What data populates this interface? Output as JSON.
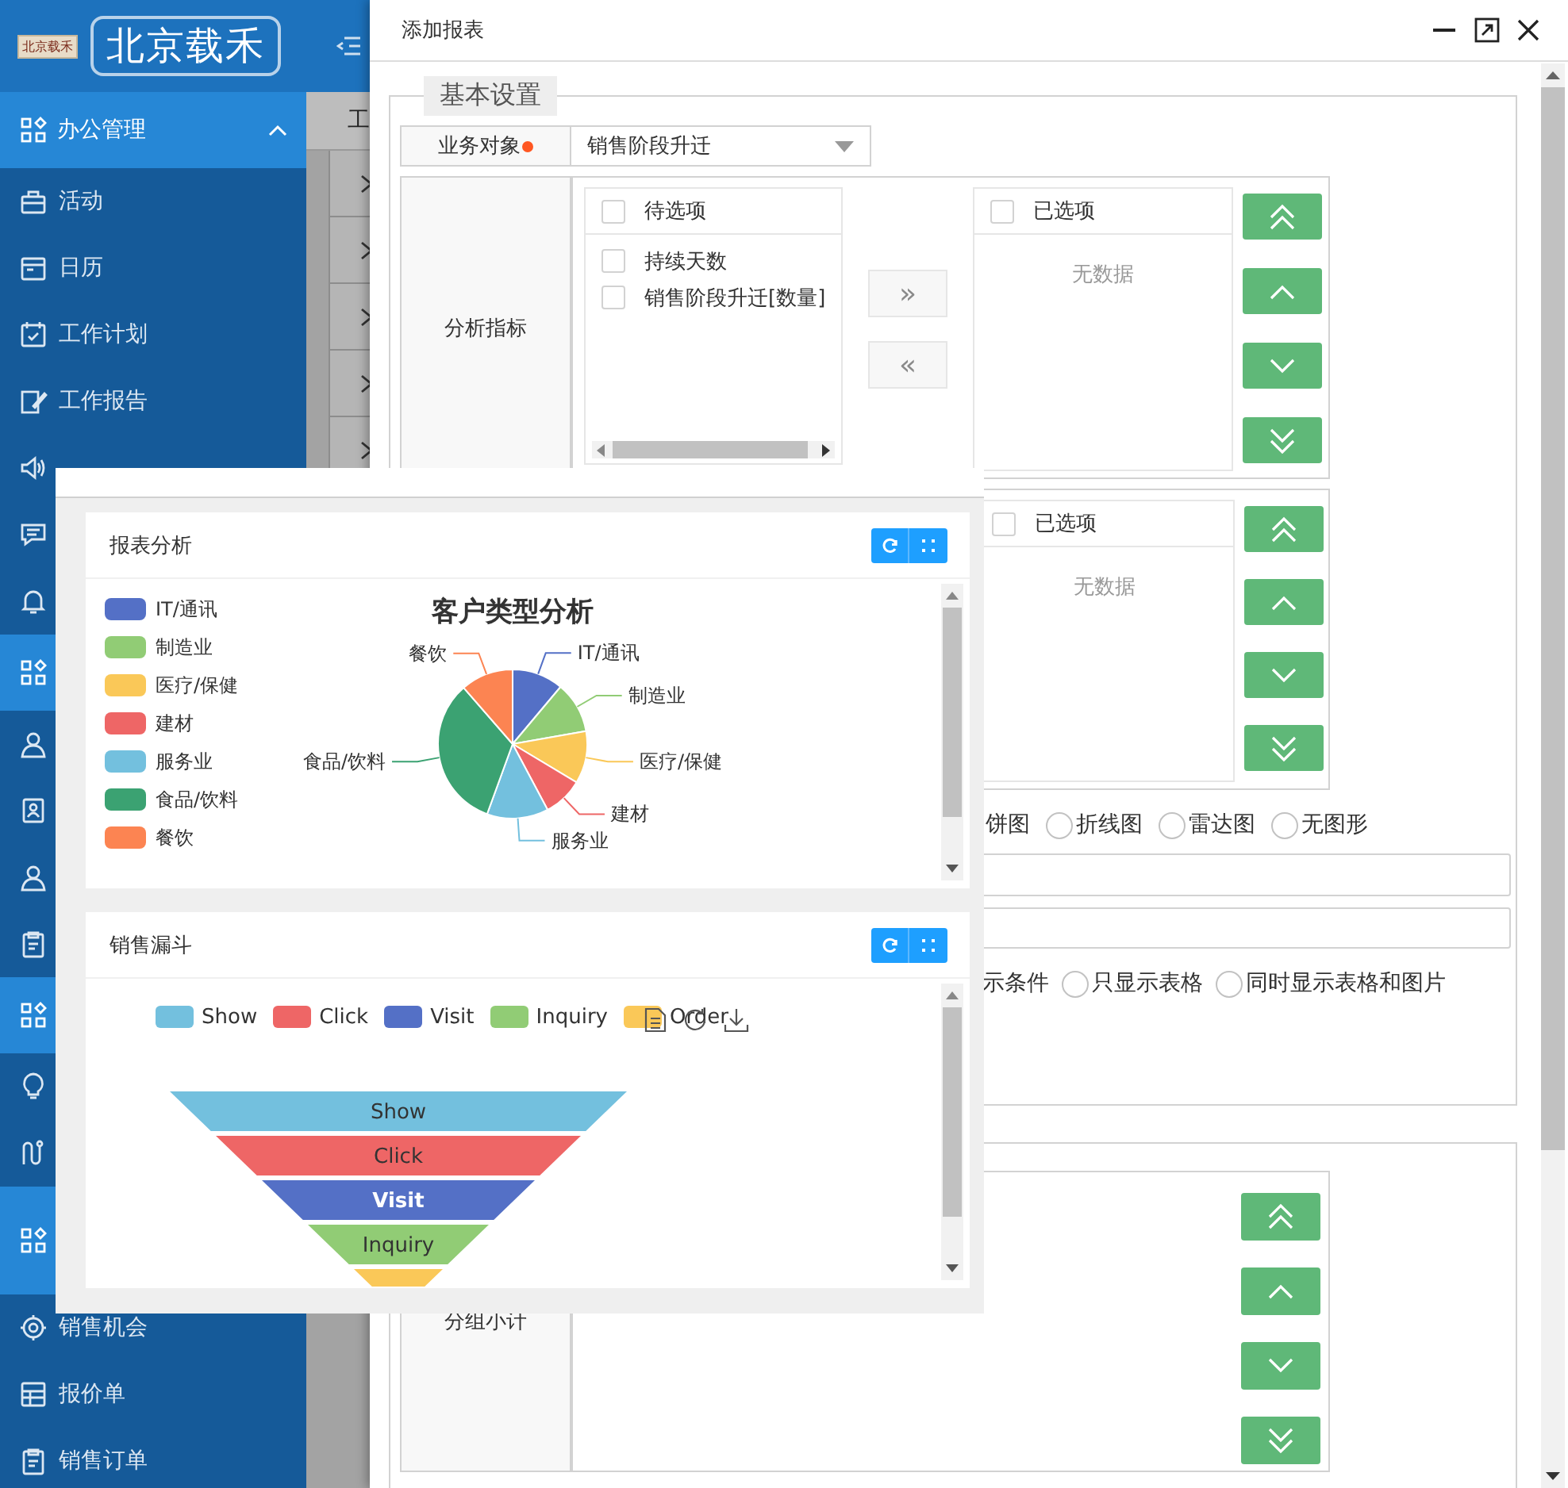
{
  "sidebar": {
    "logo_small": "北京载禾",
    "logo": "北京载禾",
    "items": [
      {
        "kind": "group",
        "label": "办公管理",
        "expanded": true
      },
      {
        "kind": "item",
        "label": "活动"
      },
      {
        "kind": "item",
        "label": "日历"
      },
      {
        "kind": "item",
        "label": "工作计划"
      },
      {
        "kind": "item",
        "label": "工作报告"
      },
      {
        "kind": "item"
      },
      {
        "kind": "item"
      },
      {
        "kind": "item"
      },
      {
        "kind": "group"
      },
      {
        "kind": "item"
      },
      {
        "kind": "item"
      },
      {
        "kind": "item"
      },
      {
        "kind": "item"
      },
      {
        "kind": "group"
      },
      {
        "kind": "item"
      },
      {
        "kind": "item"
      },
      {
        "kind": "group"
      },
      {
        "kind": "item",
        "label": "销售机会"
      },
      {
        "kind": "item",
        "label": "报价单"
      },
      {
        "kind": "item",
        "label": "销售订单"
      }
    ]
  },
  "backdrop": {
    "tab_label": "工"
  },
  "dialog": {
    "title": "添加报表",
    "basic": {
      "legend": "基本设置",
      "object_label": "业务对象",
      "required": true,
      "object_value": "销售阶段升迁",
      "metric_label": "分析指标",
      "source": {
        "header": "待选项",
        "checked": false,
        "items": [
          {
            "label": "持续天数",
            "checked": false
          },
          {
            "label": "销售阶段升迁[数量]",
            "checked": false
          }
        ]
      },
      "move_buttons": [
        {
          "label": "»",
          "disabled": true
        },
        {
          "label": "«",
          "disabled": true
        }
      ],
      "targets": [
        {
          "header": "已选项",
          "checked": false,
          "empty_text": "无数据"
        },
        {
          "header": "已选项",
          "checked": false,
          "empty_text": "无数据"
        }
      ],
      "chart_lead": "饼图",
      "chart_types": [
        {
          "label": "折线图",
          "selected": false
        },
        {
          "label": "雷达图",
          "selected": false
        },
        {
          "label": "无图形",
          "selected": false
        }
      ],
      "display_lead": "示条件",
      "display_options": [
        {
          "label": "只显示表格",
          "selected": false
        },
        {
          "label": "同时显示表格和图片",
          "selected": false
        }
      ]
    },
    "group_label": "分组小计"
  },
  "overlay": {
    "cards": [
      {
        "kind": "pie",
        "title": "报表分析",
        "chart_title": "客户类型分析",
        "legend": [
          {
            "label": "IT/通讯",
            "color": "#5470c6"
          },
          {
            "label": "制造业",
            "color": "#91cc75"
          },
          {
            "label": "医疗/保健",
            "color": "#fac858"
          },
          {
            "label": "建材",
            "color": "#ee6666"
          },
          {
            "label": "服务业",
            "color": "#73c0de"
          },
          {
            "label": "食品/饮料",
            "color": "#3ba272"
          },
          {
            "label": "餐饮",
            "color": "#fc8452"
          }
        ],
        "slice_labels": [
          "IT/通讯",
          "制造业",
          "医疗/保健",
          "建材",
          "服务业",
          "食品/饮料",
          "餐饮"
        ]
      },
      {
        "kind": "funnel",
        "title": "销售漏斗",
        "legend": [
          {
            "label": "Show",
            "color": "#73c0de"
          },
          {
            "label": "Click",
            "color": "#ee6666"
          },
          {
            "label": "Visit",
            "color": "#5470c6"
          },
          {
            "label": "Inquiry",
            "color": "#91cc75"
          },
          {
            "label": "Order",
            "color": "#fac858"
          }
        ],
        "stages": [
          {
            "label": "Show",
            "highlighted": false
          },
          {
            "label": "Click",
            "highlighted": false
          },
          {
            "label": "Visit",
            "highlighted": true
          },
          {
            "label": "Inquiry",
            "highlighted": false
          }
        ]
      }
    ]
  }
}
